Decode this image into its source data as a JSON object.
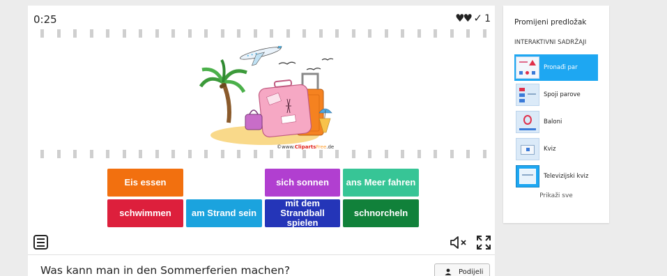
{
  "game": {
    "timer": "0:25",
    "lives_icon": "heart-icon",
    "lives": "♥♥",
    "score_icon": "checkmark-icon",
    "score": "1",
    "clip_credit": {
      "prefix": "©www.",
      "brand": "Cliparts",
      "free": "Free",
      "suffix": ".de"
    },
    "tiles": [
      {
        "label": "Eis essen",
        "color": "#f2700f"
      },
      {
        "label": "sich sonnen",
        "color": "#b13fd0"
      },
      {
        "label": "ans Meer fahren",
        "color": "#37c596"
      },
      {
        "label": "schwimmen",
        "color": "#dd1f3c"
      },
      {
        "label": "am Strand sein",
        "color": "#1ba3de"
      },
      {
        "label": "mit dem Strandball spielen",
        "color": "#2435b8"
      },
      {
        "label": "schnorcheln",
        "color": "#11813a"
      }
    ],
    "controls": {
      "menu_icon": "menu-icon",
      "mute_icon": "mute-icon",
      "fullscreen_icon": "fullscreen-icon"
    }
  },
  "activity": {
    "title": "Was kann man in den Sommerferien machen?",
    "share_label": "Podijeli",
    "share_icon": "user-icon"
  },
  "panel": {
    "title": "Promijeni predložak",
    "subtitle": "INTERAKTIVNI SADRŽAJI",
    "templates": [
      {
        "label": "Pronađi par",
        "active": true
      },
      {
        "label": "Spoji parove",
        "active": false
      },
      {
        "label": "Baloni",
        "active": false
      },
      {
        "label": "Kviz",
        "active": false
      },
      {
        "label": "Televizijski kviz",
        "active": false
      }
    ],
    "show_all": "Prikaži sve"
  },
  "colors": {
    "accent": "#1ea7f2",
    "background": "#ececec"
  }
}
